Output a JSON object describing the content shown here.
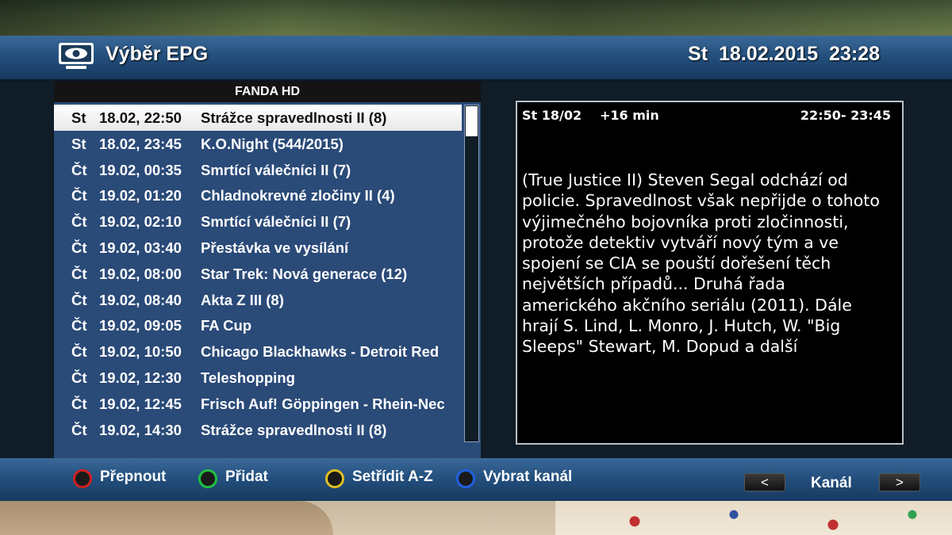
{
  "header": {
    "title": "Výběr EPG",
    "datetime": "St  18.02.2015  23:28",
    "icon": "tv-icon"
  },
  "channel": {
    "name": "FANDA HD"
  },
  "list": {
    "items": [
      {
        "day": "St",
        "date": "18.02, 22:50",
        "title": "Strážce spravedlnosti II (8)",
        "selected": true
      },
      {
        "day": "St",
        "date": "18.02, 23:45",
        "title": "K.O.Night (544/2015)",
        "selected": false
      },
      {
        "day": "Čt",
        "date": "19.02, 00:35",
        "title": "Smrtící válečníci II (7)",
        "selected": false
      },
      {
        "day": "Čt",
        "date": "19.02, 01:20",
        "title": "Chladnokrevné zločiny II (4)",
        "selected": false
      },
      {
        "day": "Čt",
        "date": "19.02, 02:10",
        "title": "Smrtící válečníci II (7)",
        "selected": false
      },
      {
        "day": "Čt",
        "date": "19.02, 03:40",
        "title": "Přestávka ve vysílání",
        "selected": false
      },
      {
        "day": "Čt",
        "date": "19.02, 08:00",
        "title": "Star Trek: Nová generace (12)",
        "selected": false
      },
      {
        "day": "Čt",
        "date": "19.02, 08:40",
        "title": "Akta Z III (8)",
        "selected": false
      },
      {
        "day": "Čt",
        "date": "19.02, 09:05",
        "title": "FA Cup",
        "selected": false
      },
      {
        "day": "Čt",
        "date": "19.02, 10:50",
        "title": "Chicago Blackhawks - Detroit Red",
        "selected": false
      },
      {
        "day": "Čt",
        "date": "19.02, 12:30",
        "title": "Teleshopping",
        "selected": false
      },
      {
        "day": "Čt",
        "date": "19.02, 12:45",
        "title": "Frisch Auf! Göppingen - Rhein-Nec",
        "selected": false
      },
      {
        "day": "Čt",
        "date": "19.02, 14:30",
        "title": "Strážce spravedlnosti II (8)",
        "selected": false
      }
    ]
  },
  "detail": {
    "day_date": "St 18/02",
    "relative": "+16 min",
    "time_range": "22:50- 23:45",
    "lines": [
      "(True Justice II) Steven Segal odchází od",
      "policie. Spravedlnost však nepřijde o tohoto",
      "výjimečného bojovníka proti zločinnosti,",
      "protože detektiv vytváří nový tým a ve",
      "spojení se CIA se pouští dořešení těch",
      "největších případů... Druhá řada",
      "amerického akčního seriálu (2011). Dále",
      "hrají S. Lind, L. Monro, J. Hutch, W. \"Big",
      "Sleeps\" Stewart, M. Dopud a další"
    ]
  },
  "footer": {
    "red": "Přepnout",
    "green": "Přidat",
    "yellow": "Setřídit A-Z",
    "blue": "Vybrat kanál",
    "prev": "<",
    "channel_label": "Kanál",
    "next": ">",
    "colors": {
      "red": "#d02020",
      "green": "#20c040",
      "yellow": "#e0c020",
      "blue": "#2060e0"
    }
  }
}
